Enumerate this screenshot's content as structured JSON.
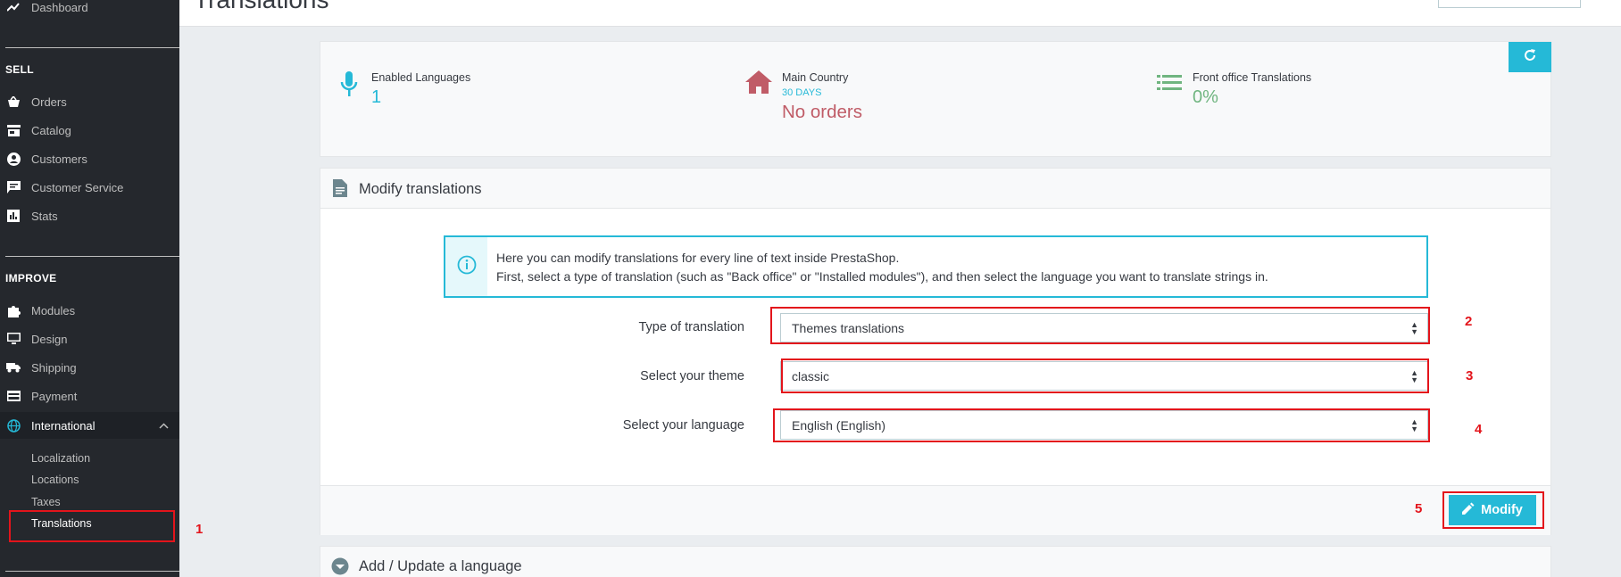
{
  "sidebar": {
    "top_item": "Dashboard",
    "sell_heading": "SELL",
    "sell_items": [
      {
        "label": "Orders",
        "icon": "basket-icon"
      },
      {
        "label": "Catalog",
        "icon": "store-icon"
      },
      {
        "label": "Customers",
        "icon": "account-circle-icon"
      },
      {
        "label": "Customer Service",
        "icon": "chat-icon"
      },
      {
        "label": "Stats",
        "icon": "bar-chart-icon"
      }
    ],
    "improve_heading": "IMPROVE",
    "improve_items": [
      {
        "label": "Modules",
        "icon": "puzzle-icon"
      },
      {
        "label": "Design",
        "icon": "monitor-icon"
      },
      {
        "label": "Shipping",
        "icon": "truck-icon"
      },
      {
        "label": "Payment",
        "icon": "credit-card-icon"
      },
      {
        "label": "International",
        "icon": "globe-icon"
      }
    ],
    "international_sub": [
      "Localization",
      "Locations",
      "Taxes",
      "Translations"
    ]
  },
  "header": {
    "title": "Translations"
  },
  "kpis": [
    {
      "label": "Enabled Languages",
      "sub": "",
      "value": "1",
      "icon": "microphone-icon"
    },
    {
      "label": "Main Country",
      "sub": "30 DAYS",
      "value": "No orders",
      "icon": "home-icon"
    },
    {
      "label": "Front office Translations",
      "sub": "",
      "value": "0%",
      "icon": "list-icon"
    }
  ],
  "panel": {
    "title": "Modify translations",
    "info_line1": "Here you can modify translations for every line of text inside PrestaShop.",
    "info_line2": "First, select a type of translation (such as \"Back office\" or \"Installed modules\"), and then select the language you want to translate strings in.",
    "type_label": "Type of translation",
    "type_value": "Themes translations",
    "theme_label": "Select your theme",
    "theme_value": "classic",
    "language_label": "Select your language",
    "language_value": "English (English)",
    "modify_label": "Modify"
  },
  "panel2": {
    "title": "Add / Update a language"
  },
  "annotations": [
    "1",
    "2",
    "3",
    "4",
    "5"
  ],
  "colors": {
    "accent": "#25b9d7",
    "danger": "#c05c67",
    "success": "#70b580",
    "annotation": "#e3141b",
    "sidebar": "#25282d"
  }
}
